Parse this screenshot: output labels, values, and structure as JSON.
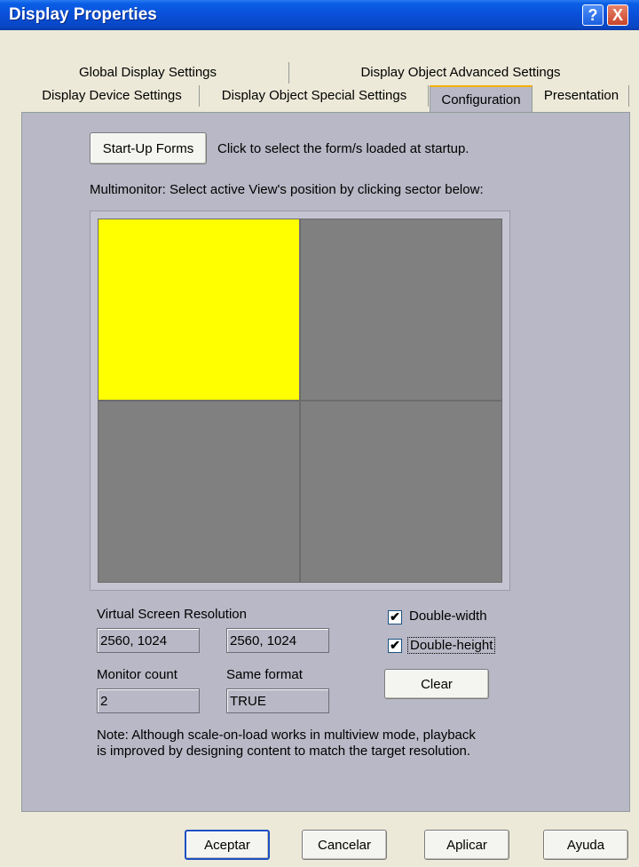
{
  "window": {
    "title": "Display Properties",
    "help_button": "?",
    "close_button": "X"
  },
  "tabs": {
    "row1": [
      "Global Display Settings",
      "Display Object Advanced Settings"
    ],
    "row2": [
      "Display Device Settings",
      "Display Object Special Settings",
      "Configuration",
      "Presentation"
    ],
    "active": "Configuration"
  },
  "config": {
    "startup_button": "Start-Up Forms",
    "startup_desc": "Click to select the form/s loaded at startup.",
    "multimonitor_label": "Multimonitor: Select active View's position by clicking sector below:",
    "grid": {
      "rows": 2,
      "cols": 2,
      "active_row": 0,
      "active_col": 0,
      "active_color": "#ffff00",
      "inactive_color": "#808080"
    },
    "virtual_res_label": "Virtual Screen Resolution",
    "virtual_res_1": "2560, 1024",
    "virtual_res_2": "2560, 1024",
    "monitor_count_label": "Monitor count",
    "monitor_count": "2",
    "same_format_label": "Same format",
    "same_format": "TRUE",
    "double_width_label": "Double-width",
    "double_width_checked": true,
    "double_height_label": "Double-height",
    "double_height_checked": true,
    "clear_button": "Clear",
    "note_line1": "Note: Although scale-on-load works in multiview mode, playback",
    "note_line2": "is improved by designing content to match the target resolution."
  },
  "footer": {
    "ok": "Aceptar",
    "cancel": "Cancelar",
    "apply": "Aplicar",
    "help": "Ayuda"
  }
}
